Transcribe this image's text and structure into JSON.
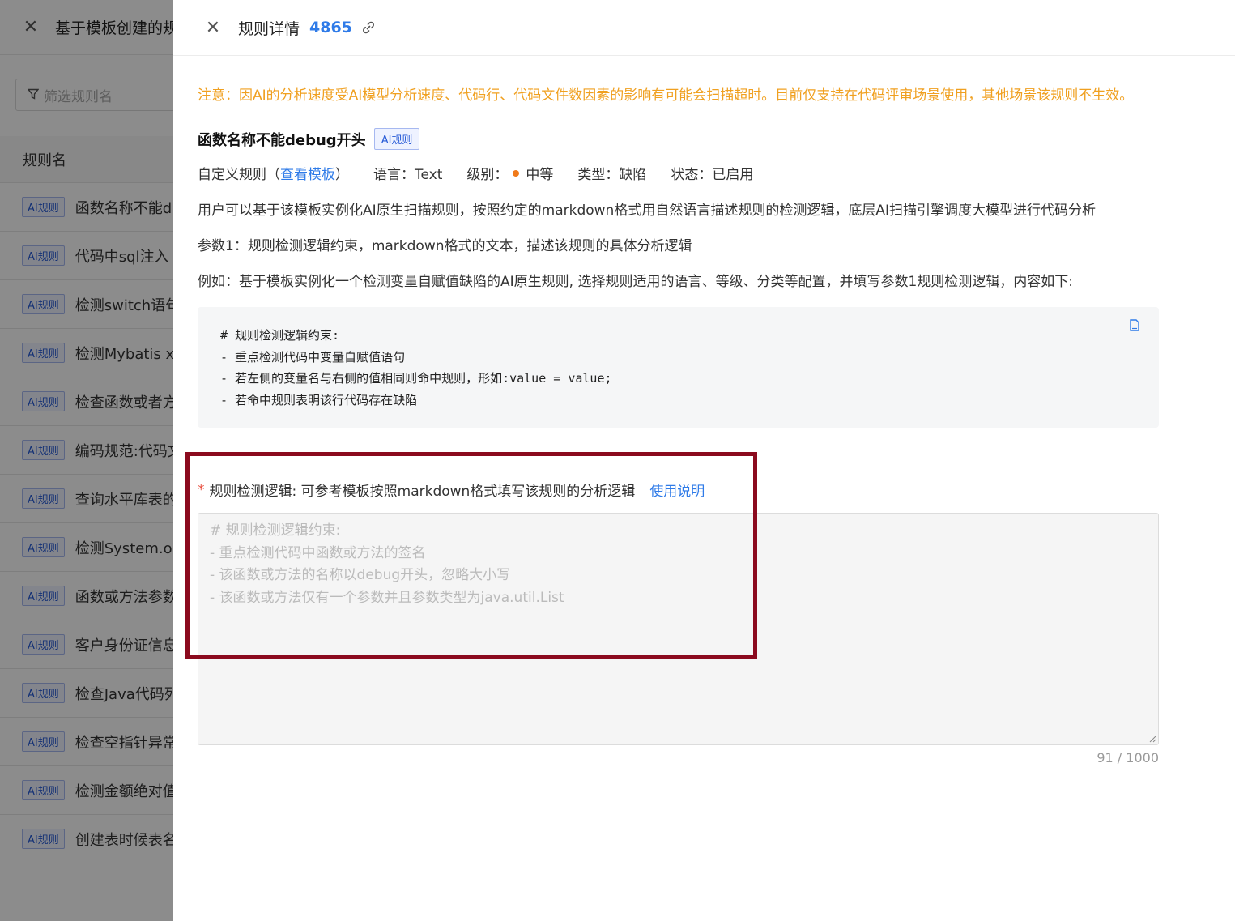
{
  "background": {
    "title": "基于模板创建的规",
    "filter_placeholder": "筛选规则名",
    "column_header": "规则名",
    "rows": [
      {
        "tag": "AI规则",
        "name": "函数名称不能d"
      },
      {
        "tag": "AI规则",
        "name": "代码中sql注入"
      },
      {
        "tag": "AI规则",
        "name": "检测switch语句"
      },
      {
        "tag": "AI规则",
        "name": "检测Mybatis xm"
      },
      {
        "tag": "AI规则",
        "name": "检查函数或者方"
      },
      {
        "tag": "AI规则",
        "name": "编码规范:代码文"
      },
      {
        "tag": "AI规则",
        "name": "查询水平库表的"
      },
      {
        "tag": "AI规则",
        "name": "检测System.ou"
      },
      {
        "tag": "AI规则",
        "name": "函数或方法参数"
      },
      {
        "tag": "AI规则",
        "name": "客户身份证信息"
      },
      {
        "tag": "AI规则",
        "name": "检查Java代码列"
      },
      {
        "tag": "AI规则",
        "name": "检查空指针异常"
      },
      {
        "tag": "AI规则",
        "name": "检测金额绝对值"
      },
      {
        "tag": "AI规则",
        "name": "创建表时候表名"
      }
    ]
  },
  "drawer": {
    "title": "规则详情",
    "rule_id": "4865",
    "notice": "注意：因AI的分析速度受AI模型分析速度、代码行、代码文件数因素的影响有可能会扫描超时。目前仅支持在代码评审场景使用，其他场景该规则不生效。",
    "rule_name": "函数名称不能debug开头",
    "rule_tag": "AI规则",
    "meta": {
      "custom_prefix": "自定义规则（",
      "template_link": "查看模板",
      "custom_suffix": "）",
      "language": "语言：Text",
      "level_label": "级别：",
      "level_value": "中等",
      "type": "类型：缺陷",
      "status": "状态：已启用"
    },
    "description": "用户可以基于该模板实例化AI原生扫描规则，按照约定的markdown格式用自然语言描述规则的检测逻辑，底层AI扫描引擎调度大模型进行代码分析",
    "param1": "参数1：规则检测逻辑约束，markdown格式的文本，描述该规则的具体分析逻辑",
    "example": "例如：基于模板实例化一个检测变量自赋值缺陷的AI原生规则, 选择规则适用的语言、等级、分类等配置，并填写参数1规则检测逻辑，内容如下:",
    "code_lines": [
      "# 规则检测逻辑约束:",
      "- 重点检测代码中变量自赋值语句",
      "- 若左侧的变量名与右侧的值相同则命中规则，形如:value = value;",
      "- 若命中规则表明该行代码存在缺陷"
    ],
    "field": {
      "required_mark": "*",
      "label": "规则检测逻辑: 可参考模板按照markdown格式填写该规则的分析逻辑",
      "usage_link": "使用说明",
      "placeholder_lines": [
        "# 规则检测逻辑约束:",
        "- 重点检测代码中函数或方法的签名",
        "- 该函数或方法的名称以debug开头，忽略大小写",
        "- 该函数或方法仅有一个参数并且参数类型为java.util.List"
      ],
      "counter": "91 / 1000"
    },
    "colors": {
      "accent": "#2f7be8",
      "notice": "#f0a020",
      "level_dot": "#f07a1a",
      "highlight": "#8b0a1e"
    }
  }
}
